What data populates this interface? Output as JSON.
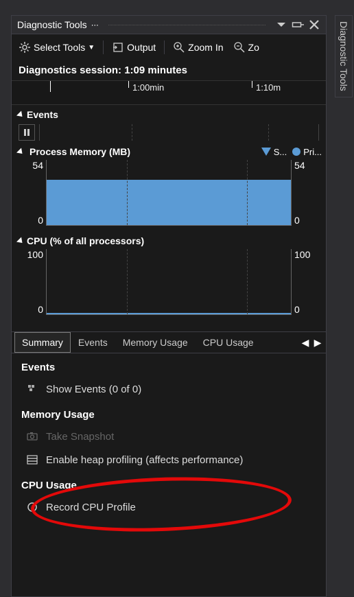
{
  "window": {
    "title": "Diagnostic Tools",
    "sidebar_tab": "Diagnostic Tools"
  },
  "toolbar": {
    "select_tools": "Select Tools",
    "output": "Output",
    "zoom_in": "Zoom In",
    "zoom_out": "Zo"
  },
  "session": {
    "label": "Diagnostics session: 1:09 minutes"
  },
  "timeline": {
    "ticks": [
      "1:00min",
      "1:10m"
    ]
  },
  "sections": {
    "events": "Events",
    "process_memory": "Process Memory (MB)",
    "cpu": "CPU (% of all processors)"
  },
  "legend": {
    "snapshot": "S...",
    "private": "Pri..."
  },
  "chart_data": [
    {
      "type": "area",
      "name": "Process Memory (MB)",
      "ylim": [
        0,
        54
      ],
      "ylabel": "",
      "series": [
        {
          "name": "Private Bytes",
          "value_constant": 38
        }
      ],
      "y_ticks_left": [
        "54",
        "0"
      ],
      "y_ticks_right": [
        "54",
        "0"
      ]
    },
    {
      "type": "area",
      "name": "CPU (% of all processors)",
      "ylim": [
        0,
        100
      ],
      "ylabel": "",
      "series": [
        {
          "name": "CPU",
          "value_constant": 1
        }
      ],
      "y_ticks_left": [
        "100",
        "0"
      ],
      "y_ticks_right": [
        "100",
        "0"
      ]
    }
  ],
  "tabs": {
    "items": [
      "Summary",
      "Events",
      "Memory Usage",
      "CPU Usage"
    ],
    "active": 0
  },
  "summary": {
    "events_title": "Events",
    "show_events": "Show Events (0 of 0)",
    "memory_title": "Memory Usage",
    "take_snapshot": "Take Snapshot",
    "enable_heap": "Enable heap profiling (affects performance)",
    "cpu_title": "CPU Usage",
    "record_cpu": "Record CPU Profile"
  }
}
